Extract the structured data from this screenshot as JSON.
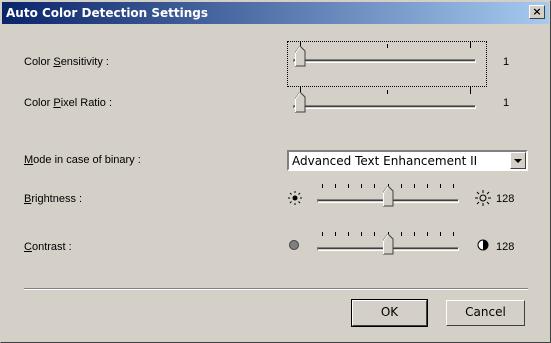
{
  "window": {
    "title": "Auto Color Detection Settings",
    "close_glyph": "×"
  },
  "settings": {
    "color_sensitivity": {
      "label_pre": "Color ",
      "label_key": "S",
      "label_post": "ensitivity :",
      "value": "1",
      "level_min": 1
    },
    "color_pixel_ratio": {
      "label_pre": "Color ",
      "label_key": "P",
      "label_post": "ixel Ratio :",
      "value": "1",
      "level_min": 1
    },
    "binary_mode": {
      "label_pre": "",
      "label_key": "M",
      "label_post": "ode in case of binary :",
      "selected": "Advanced Text Enhancement II"
    },
    "brightness": {
      "label_pre": "",
      "label_key": "B",
      "label_post": "rightness :",
      "value": "128",
      "low_icon": "sun-small-icon",
      "high_icon": "sun-large-icon"
    },
    "contrast": {
      "label_pre": "",
      "label_key": "C",
      "label_post": "ontrast :",
      "value": "128",
      "low_icon": "contrast-low-icon",
      "high_icon": "contrast-high-icon"
    }
  },
  "buttons": {
    "ok": "OK",
    "cancel": "Cancel"
  }
}
